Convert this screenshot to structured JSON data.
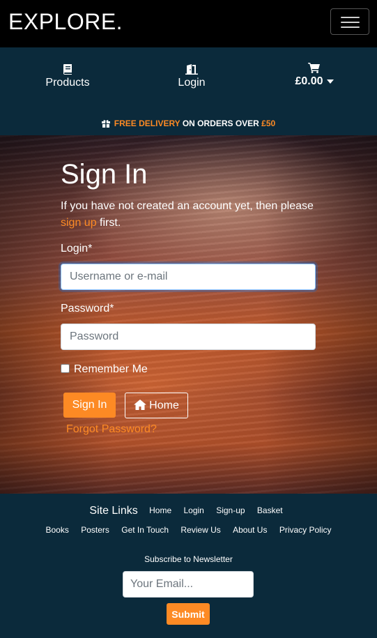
{
  "brand": "EXPLORE.",
  "nav": {
    "products_label": "Products",
    "login_label": "Login",
    "basket_total": "£0.00"
  },
  "banner": {
    "free_delivery": "FREE DELIVERY",
    "middle": "ON ORDERS OVER",
    "threshold": "£50"
  },
  "signin": {
    "title": "Sign In",
    "intro_prefix": "If you have not created an account yet, then please",
    "intro_link": "sign up",
    "intro_suffix": "first.",
    "login_label": "Login*",
    "login_placeholder": "Username or e-mail",
    "password_label": "Password*",
    "password_placeholder": "Password",
    "remember_label": "Remember Me",
    "signin_button": "Sign In",
    "home_button": "Home",
    "forgot_link": "Forgot Password?"
  },
  "footer": {
    "site_links_title": "Site Links",
    "row1": [
      "Home",
      "Login",
      "Sign-up",
      "Basket"
    ],
    "row2": [
      "Books",
      "Posters",
      "Get In Touch",
      "Review Us",
      "About Us",
      "Privacy Policy"
    ],
    "subscribe_label": "Subscribe to Newsletter",
    "email_placeholder": "Your Email...",
    "submit_label": "Submit"
  },
  "colors": {
    "accent": "#fd8a24",
    "navy": "#0b2a3b",
    "topbar": "#000000"
  },
  "icons": {
    "products": "book-icon",
    "login": "door-icon",
    "basket": "cart-icon",
    "banner": "gift-icon",
    "home": "home-icon",
    "menu": "hamburger-icon"
  }
}
